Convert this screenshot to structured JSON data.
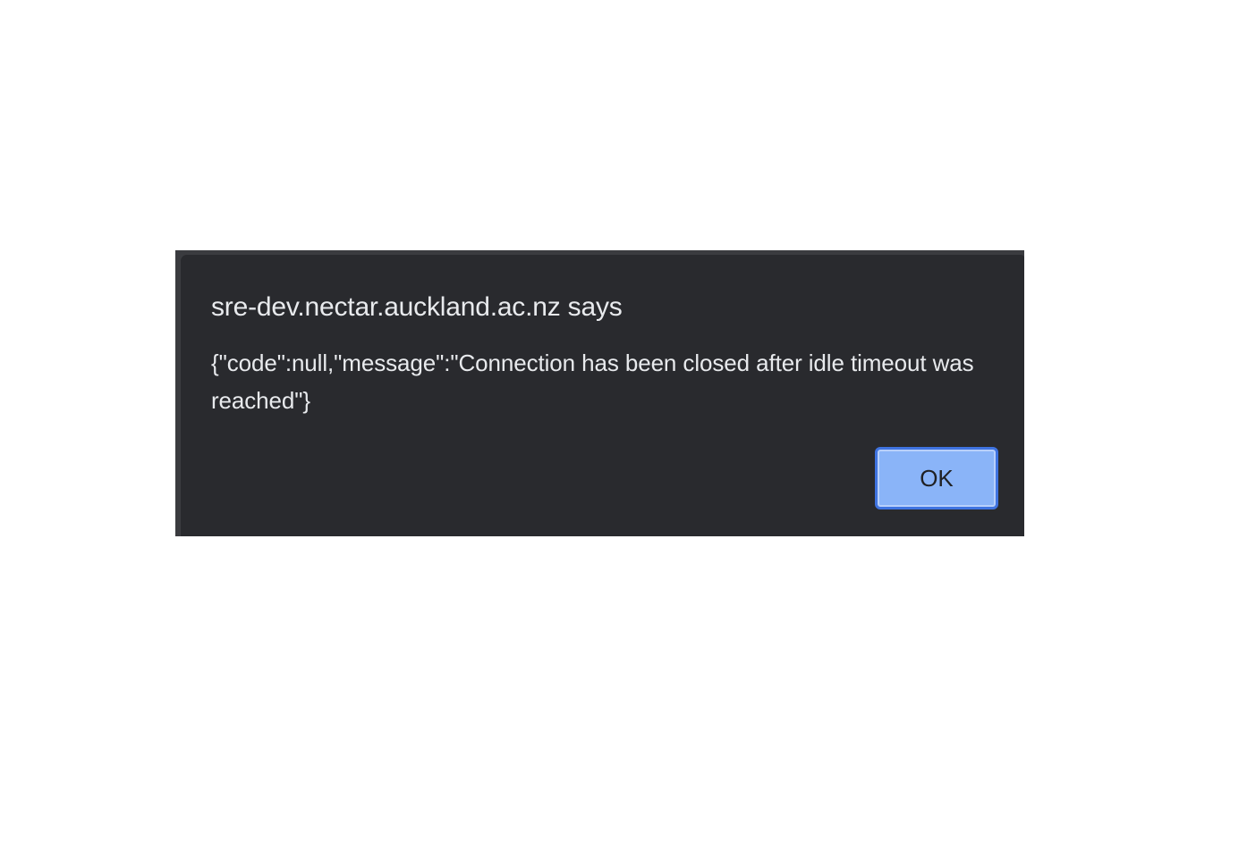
{
  "dialog": {
    "title": "sre-dev.nectar.auckland.ac.nz says",
    "message": "{\"code\":null,\"message\":\"Connection has been closed after idle timeout was reached\"}",
    "ok_label": "OK"
  },
  "colors": {
    "dialog_background": "#292a2e",
    "text": "#e8eaed",
    "button_background": "#8ab4f8",
    "button_focus_ring": "#3f73e0"
  }
}
